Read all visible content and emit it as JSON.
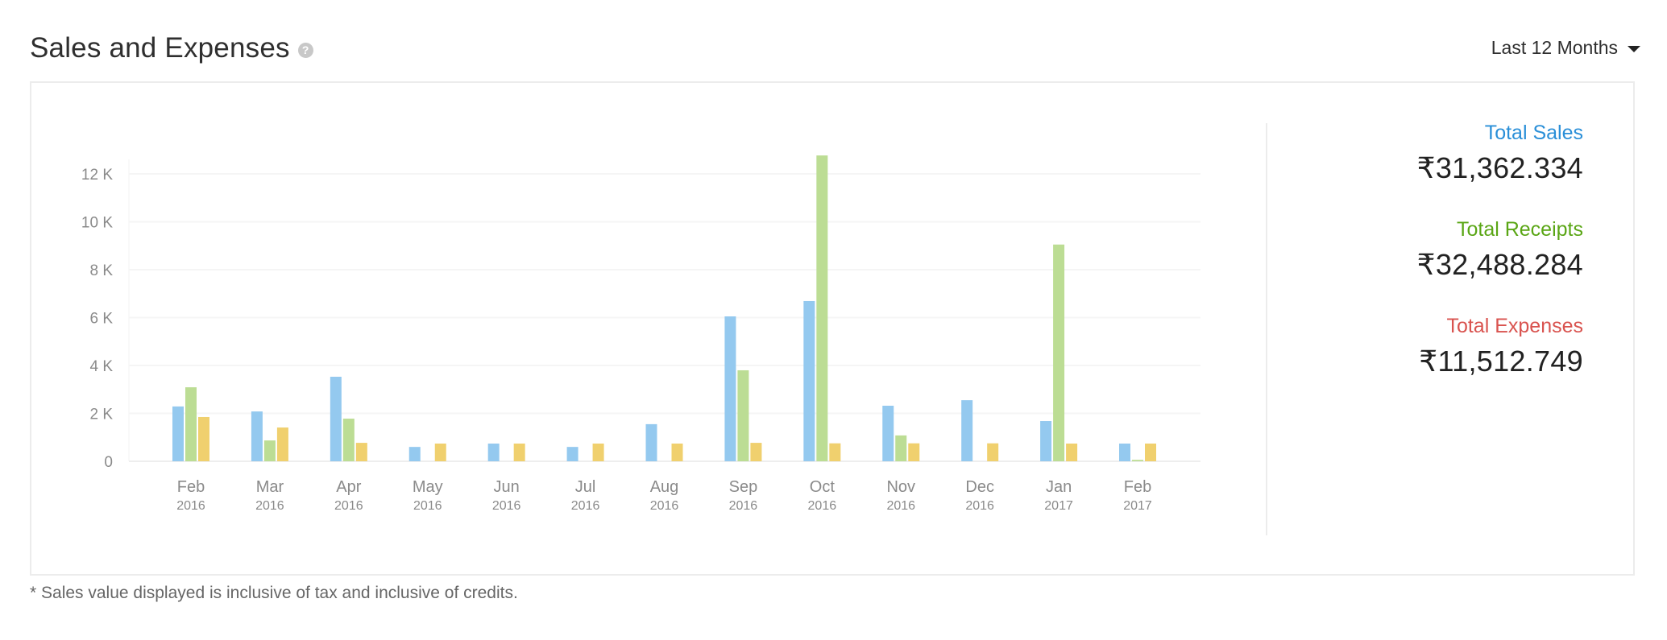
{
  "header": {
    "title": "Sales and Expenses",
    "help_icon": "question-circle-icon",
    "range_label": "Last 12 Months",
    "range_icon": "caret-down-icon"
  },
  "summary": {
    "items": [
      {
        "label": "Total Sales",
        "value": "₹31,362.334",
        "color": "#2a8fd8"
      },
      {
        "label": "Total Receipts",
        "value": "₹32,488.284",
        "color": "#5aa615"
      },
      {
        "label": "Total Expenses",
        "value": "₹11,512.749",
        "color": "#d9534f"
      }
    ]
  },
  "footnote": "* Sales value displayed is inclusive of tax and inclusive of credits.",
  "chart_data": {
    "type": "bar",
    "title": "",
    "xlabel": "",
    "ylabel": "",
    "ylim": [
      0,
      12000
    ],
    "grid": true,
    "yticks": [
      0,
      2000,
      4000,
      6000,
      8000,
      10000,
      12000
    ],
    "ytick_labels": [
      "0",
      "2 K",
      "4 K",
      "6 K",
      "8 K",
      "10 K",
      "12 K"
    ],
    "categories": [
      {
        "month": "Feb",
        "year": "2016"
      },
      {
        "month": "Mar",
        "year": "2016"
      },
      {
        "month": "Apr",
        "year": "2016"
      },
      {
        "month": "May",
        "year": "2016"
      },
      {
        "month": "Jun",
        "year": "2016"
      },
      {
        "month": "Jul",
        "year": "2016"
      },
      {
        "month": "Aug",
        "year": "2016"
      },
      {
        "month": "Sep",
        "year": "2016"
      },
      {
        "month": "Oct",
        "year": "2016"
      },
      {
        "month": "Nov",
        "year": "2016"
      },
      {
        "month": "Dec",
        "year": "2016"
      },
      {
        "month": "Jan",
        "year": "2017"
      },
      {
        "month": "Feb",
        "year": "2017"
      }
    ],
    "series": [
      {
        "name": "Sales",
        "color": "#94c9ef",
        "values": [
          2290,
          2080,
          3530,
          600,
          740,
          600,
          1550,
          6050,
          6690,
          2320,
          2550,
          1680,
          740
        ]
      },
      {
        "name": "Receipts",
        "color": "#bcdd94",
        "values": [
          3090,
          870,
          1780,
          0,
          0,
          0,
          0,
          3800,
          12770,
          1080,
          0,
          9050,
          60
        ]
      },
      {
        "name": "Expenses",
        "color": "#f0d06e",
        "values": [
          1850,
          1410,
          770,
          740,
          740,
          740,
          740,
          770,
          750,
          750,
          750,
          740,
          740
        ]
      }
    ],
    "legend": "right-summary"
  }
}
